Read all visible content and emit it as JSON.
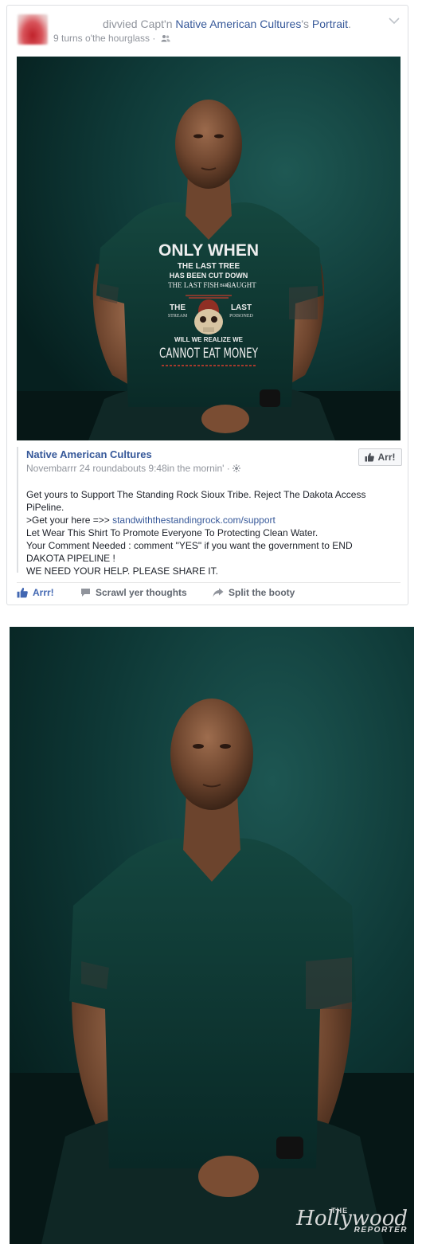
{
  "post": {
    "header_prefix": "divvied Capt'n ",
    "header_page": "Native American Cultures",
    "header_mid": "'s ",
    "header_link": "Portrait",
    "header_suffix": ".",
    "meta_time": "9 turns o'the hourglass · "
  },
  "shirt": {
    "line1": "ONLY WHEN",
    "line2": "THE LAST TREE",
    "line3": "HAS BEEN CUT DOWN",
    "line4a": "THE LAST FISH",
    "line4b": "BEEN",
    "line4c": "CAUGHT",
    "the": "THE",
    "last": "LAST",
    "stream": "STREAM",
    "poisoned": "POISONED",
    "line6": "WILL WE REALIZE WE",
    "line7": "CANNOT EAT MONEY"
  },
  "shared": {
    "page_name": "Native American Cultures",
    "timestamp": "Novembarrr 24 roundabouts 9:48in the mornin' · ",
    "like_label": "Arr!",
    "lines": [
      "Get yours to Support The Standing Rock Sioux Tribe. Reject The Dakota Access PiPeline.",
      ">Get your here =>> ",
      "Let Wear This Shirt To Promote Everyone To Protecting Clean Water.",
      "Your Comment Needed : comment \"YES\" if you want the government to END DAKOTA PIPELINE !",
      "WE NEED YOUR HELP. PLEASE SHARE IT."
    ],
    "url": "standwiththestandingrock.com/support"
  },
  "actions": {
    "like": "Arrr!",
    "comment": "Scrawl yer thoughts",
    "share": "Split the booty"
  },
  "watermark": {
    "the": "THE",
    "name": "Hollywood",
    "reporter": "REPORTER"
  },
  "colors": {
    "link": "#365899",
    "like_blue": "#4267b2",
    "meta_gray": "#90949c",
    "shirt_green": "#11403b",
    "backdrop_teal": "#0f3a38"
  }
}
